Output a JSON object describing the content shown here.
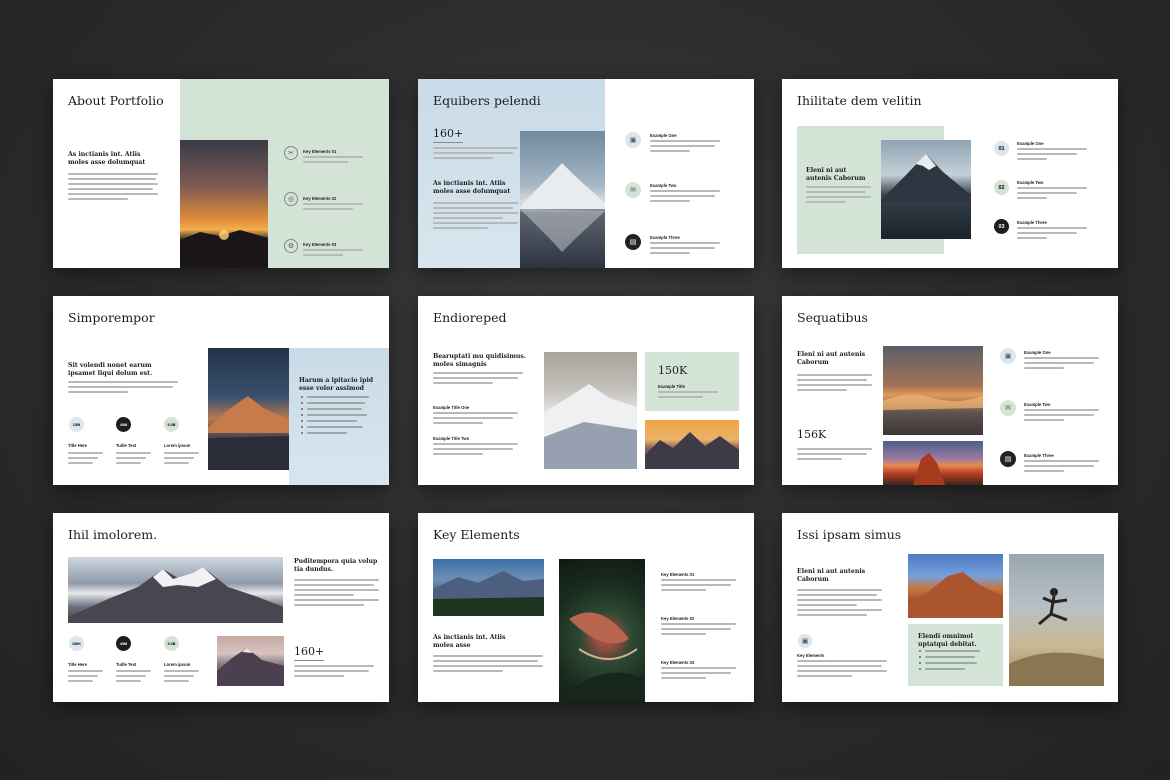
{
  "colors": {
    "mint": "#d3e4d6",
    "mint_light": "#dfeae1",
    "icon_blue": "#dbe6ee",
    "dark": "#1d1d1d"
  },
  "s1": {
    "title": "About Portfolio",
    "heading": "As inctianis int. Atiis moles asse dolumquat",
    "items": [
      {
        "label": "Key Elements 01",
        "icon": "tools-icon"
      },
      {
        "label": "Key Elements 02",
        "icon": "target-icon"
      },
      {
        "label": "Key Elements 03",
        "icon": "gear-icon"
      }
    ]
  },
  "s2": {
    "title": "Equibers pelendi",
    "bignum": "160+",
    "heading": "As inctianis int. Atiis moles asse dolumquat",
    "items": [
      {
        "label": "Example One",
        "icon": "briefcase-icon"
      },
      {
        "label": "Example Two",
        "icon": "chat-icon"
      },
      {
        "label": "Example Three",
        "icon": "document-icon"
      }
    ]
  },
  "s3": {
    "title": "Ihilitate dem velitin",
    "heading": "Eleni ni aut autenis Caborum",
    "items": [
      {
        "num": "01",
        "label": "Example One"
      },
      {
        "num": "02",
        "label": "Example Two"
      },
      {
        "num": "03",
        "label": "Example Three"
      }
    ]
  },
  "s4": {
    "title": "Simporempor",
    "heading": "Sit volendi nonet earum ipsamet liqui dolum est.",
    "panel_heading": "Harum a ipitacio ipid esse volor assimod",
    "stats": [
      {
        "value": "15M",
        "label": "Title Here"
      },
      {
        "value": "40M",
        "label": "Tuitle Text"
      },
      {
        "value": "5.3B",
        "label": "Lorem ipsum"
      }
    ]
  },
  "s5": {
    "title": "Endioreped",
    "heading": "Bearuptati mu quidisimus. moles simagnis",
    "item1": "Example Title One",
    "item2": "Example Title Two",
    "bignum": "150K",
    "card_label": "Example Title"
  },
  "s6": {
    "title": "Sequatibus",
    "heading": "Eleni ni aut autenis Caborum",
    "bignum": "156K",
    "items": [
      {
        "label": "Example One",
        "icon": "briefcase-icon"
      },
      {
        "label": "Example Two",
        "icon": "chat-icon"
      },
      {
        "label": "Example Three",
        "icon": "document-icon"
      }
    ]
  },
  "s7": {
    "title": "Ihil imolorem.",
    "heading": "Puditempora quia volup tia dundus.",
    "bignum": "160+",
    "stats": [
      {
        "value": "150K",
        "label": "Title Here"
      },
      {
        "value": "40M",
        "label": "Tuitle Text"
      },
      {
        "value": "5.3B",
        "label": "Lorem ipsum"
      }
    ]
  },
  "s8": {
    "title": "Key Elements",
    "heading": "As inctianis int. Atiis moles asse",
    "items": [
      "Key Elements 01",
      "Key Elements 02",
      "Key Elements 03"
    ]
  },
  "s9": {
    "title": "Issi ipsam simus",
    "heading": "Eleni ni aut autenis Caborum",
    "key_label": "Key Elements",
    "card_heading": "Elendi omnimol uptatqui debitat."
  }
}
